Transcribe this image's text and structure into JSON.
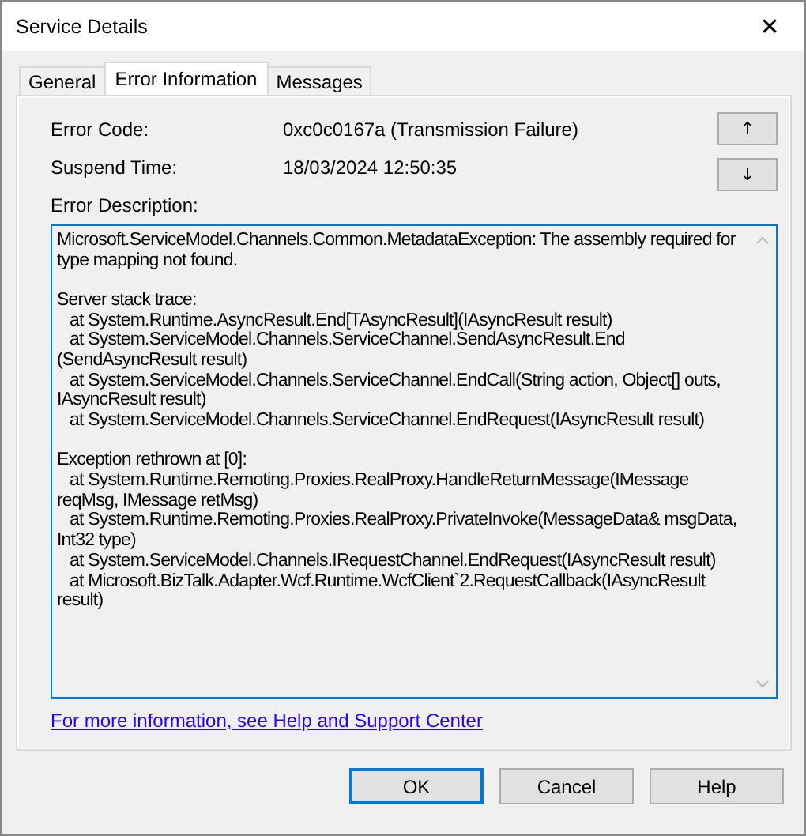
{
  "window": {
    "title": "Service Details",
    "close": "✕"
  },
  "tabs": [
    {
      "label": "General",
      "selected": false
    },
    {
      "label": "Error Information",
      "selected": true
    },
    {
      "label": "Messages",
      "selected": false
    }
  ],
  "fields": [
    {
      "label": "Error Code:",
      "value": "0xc0c0167a (Transmission Failure)"
    },
    {
      "label": "Suspend Time:",
      "value": "18/03/2024 12:50:35"
    }
  ],
  "nav_buttons": [
    "↑",
    "↓"
  ],
  "description": {
    "label": "Error Description:",
    "paragraphs": [
      {
        "heading": "Microsoft.ServiceModel.Channels.Common.MetadataException: The assembly required for type mapping not found."
      },
      {
        "heading": "Server stack trace:",
        "frames": [
          "at System.Runtime.AsyncResult.End[TAsyncResult](IAsyncResult result)",
          "at System.ServiceModel.Channels.ServiceChannel.SendAsyncResult.End (SendAsyncResult result)",
          "at System.ServiceModel.Channels.ServiceChannel.EndCall(String action, Object[] outs, IAsyncResult result)",
          "at System.ServiceModel.Channels.ServiceChannel.EndRequest(IAsyncResult result)"
        ]
      },
      {
        "heading": "Exception rethrown at [0]:",
        "frames": [
          "at System.Runtime.Remoting.Proxies.RealProxy.HandleReturnMessage(IMessage reqMsg, IMessage retMsg)",
          "at System.Runtime.Remoting.Proxies.RealProxy.PrivateInvoke(MessageData& msgData, Int32 type)",
          "at System.ServiceModel.Channels.IRequestChannel.EndRequest(IAsyncResult result)",
          "at Microsoft.BizTalk.Adapter.Wcf.Runtime.WcfClient`2.RequestCallback(IAsyncResult result)"
        ]
      }
    ]
  },
  "help_link": "For more information, see Help and Support Center",
  "buttons": [
    {
      "label": "OK",
      "default": true
    },
    {
      "label": "Cancel",
      "default": false
    },
    {
      "label": "Help",
      "default": false
    }
  ]
}
